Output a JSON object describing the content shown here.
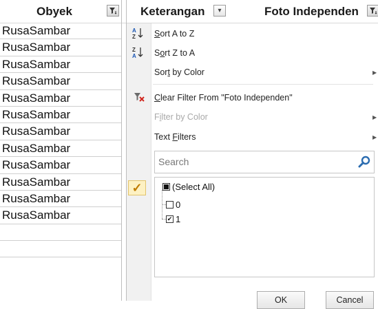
{
  "columns": {
    "a_header": "Obyek",
    "b_header": "Keterangan",
    "c_header": "Foto Independen"
  },
  "column_a_values": [
    "RusaSambar",
    "RusaSambar",
    "RusaSambar",
    "RusaSambar",
    "RusaSambar",
    "RusaSambar",
    "RusaSambar",
    "RusaSambar",
    "RusaSambar",
    "RusaSambar",
    "RusaSambar",
    "RusaSambar",
    "",
    ""
  ],
  "menu": {
    "sort_az": {
      "pre": "",
      "key": "S",
      "post": "ort A to Z"
    },
    "sort_za": {
      "pre": "S",
      "key": "o",
      "post": "rt Z to A"
    },
    "sort_by_color": {
      "pre": "Sor",
      "key": "t",
      "post": " by Color"
    },
    "clear_filter": {
      "pre": "",
      "key": "C",
      "post": "lear Filter From \"Foto Independen\""
    },
    "filter_by_color": {
      "pre": "F",
      "key": "i",
      "post": "lter by Color"
    },
    "text_filters": {
      "pre": "Text ",
      "key": "F",
      "post": "ilters"
    },
    "search_placeholder": "Search",
    "list": [
      {
        "label": "(Select All)",
        "state": "partial"
      },
      {
        "label": "0",
        "state": "unchecked"
      },
      {
        "label": "1",
        "state": "checked"
      }
    ],
    "ok_label": "OK",
    "cancel_label": "Cancel"
  },
  "colors": {
    "check_accent": "#c07c00",
    "check_bg": "#fdf1c3",
    "search_icon": "#2b6cb0"
  }
}
